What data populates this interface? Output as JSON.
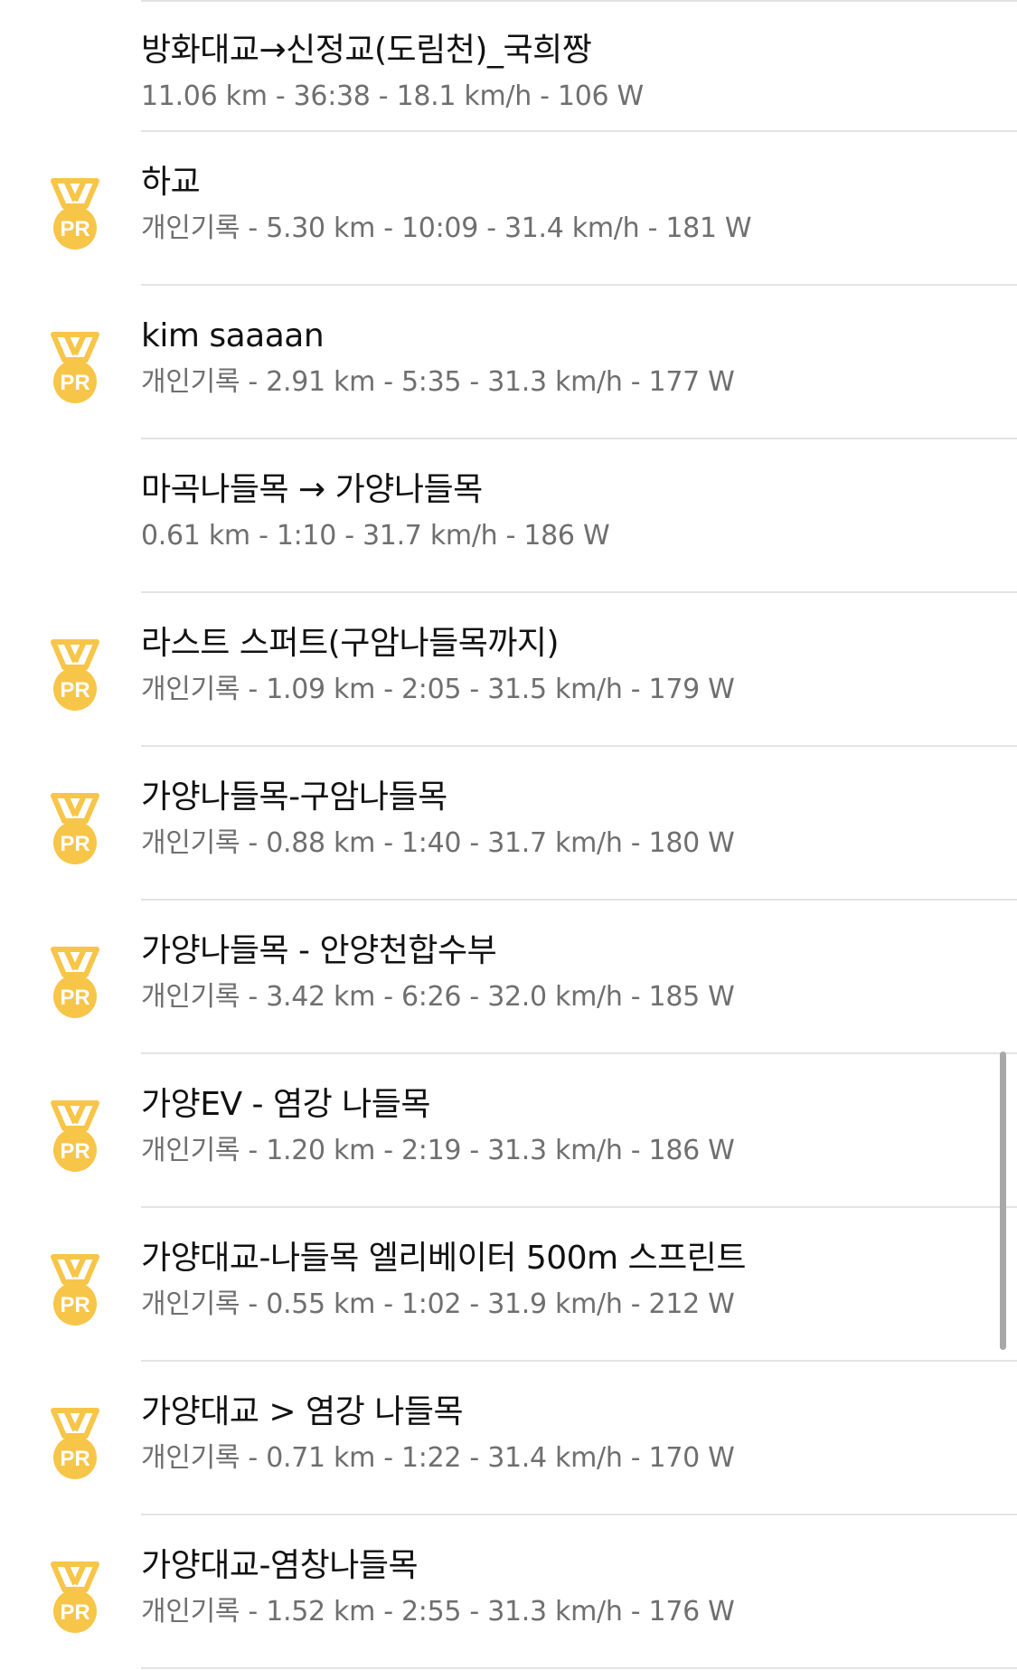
{
  "accent_color": "#F7C548",
  "badge": {
    "label": "PR",
    "icon": "pr-medal-icon"
  },
  "segments": [
    {
      "name": "방화대교→신정교(도림천)_국희짱",
      "stats": "11.06 km - 36:38 - 18.1 km/h - 106 W",
      "pr": false
    },
    {
      "name": "하교",
      "stats": "개인기록 - 5.30 km - 10:09 - 31.4 km/h - 181 W",
      "pr": true
    },
    {
      "name": "kim saaaan",
      "stats": "개인기록 - 2.91 km - 5:35 - 31.3 km/h - 177 W",
      "pr": true
    },
    {
      "name": "마곡나들목 → 가양나들목",
      "stats": "0.61 km - 1:10 - 31.7 km/h - 186 W",
      "pr": false
    },
    {
      "name": "라스트 스퍼트(구암나들목까지)",
      "stats": "개인기록 - 1.09 km - 2:05 - 31.5 km/h - 179 W",
      "pr": true
    },
    {
      "name": "가양나들목-구암나들목",
      "stats": "개인기록 - 0.88 km - 1:40 - 31.7 km/h - 180 W",
      "pr": true
    },
    {
      "name": "가양나들목 - 안양천합수부",
      "stats": "개인기록 - 3.42 km - 6:26 - 32.0 km/h - 185 W",
      "pr": true
    },
    {
      "name": "가양EV - 염강 나들목",
      "stats": "개인기록 - 1.20 km - 2:19 - 31.3 km/h - 186 W",
      "pr": true
    },
    {
      "name": "가양대교-나들목 엘리베이터 500m 스프린트",
      "stats": "개인기록 - 0.55 km - 1:02 - 31.9 km/h - 212 W",
      "pr": true
    },
    {
      "name": "가양대교 > 염강 나들목",
      "stats": "개인기록 - 0.71 km - 1:22 - 31.4 km/h - 170 W",
      "pr": true
    },
    {
      "name": "가양대교-염창나들목",
      "stats": "개인기록 - 1.52 km - 2:55 - 31.3 km/h - 176 W",
      "pr": true
    }
  ]
}
